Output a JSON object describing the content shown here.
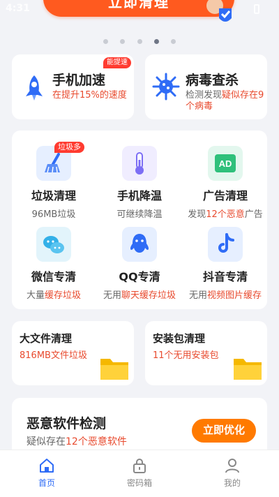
{
  "status_bar": {
    "time": "4:31"
  },
  "banner": {
    "clean_button_label": "立即清理"
  },
  "carousel": {
    "active_index": 3,
    "count": 5
  },
  "features": {
    "speedup": {
      "title": "手机加速",
      "desc": "在提升15%的速度",
      "badge": "能提速"
    },
    "antivirus": {
      "title": "病毒查杀",
      "desc_prefix": "检测发现",
      "desc_highlight": "疑似存在9个病毒"
    }
  },
  "grid": [
    {
      "title": "垃圾清理",
      "desc_plain": "",
      "desc_red": "96MB垃圾",
      "desc_tail": "",
      "badge": "垃圾多",
      "icon": "broom-icon"
    },
    {
      "title": "手机降温",
      "desc_plain": "",
      "desc_red": "可继续降温",
      "desc_tail": "",
      "icon": "thermometer-icon"
    },
    {
      "title": "广告清理",
      "desc_plain": "发现",
      "desc_red": "12个恶意",
      "desc_tail": "广告",
      "icon": "ad-icon"
    },
    {
      "title": "微信专清",
      "desc_plain": "大量",
      "desc_red": "缓存垃圾",
      "desc_tail": "",
      "icon": "wechat-icon"
    },
    {
      "title": "QQ专清",
      "desc_plain": "无用",
      "desc_red": "聊天缓存垃圾",
      "desc_tail": "",
      "icon": "qq-icon"
    },
    {
      "title": "抖音专清",
      "desc_plain": "无用",
      "desc_red": "视频图片缓存",
      "desc_tail": "",
      "icon": "tiktok-icon"
    }
  ],
  "files": {
    "large": {
      "title": "大文件清理",
      "desc": "816MB文件垃圾"
    },
    "apk": {
      "title": "安装包清理",
      "desc": "11个无用安装包"
    }
  },
  "malware": {
    "title": "恶意软件检测",
    "desc_plain": "疑似存在",
    "desc_red": "12个恶意软件",
    "button": "立即优化"
  },
  "tabs": [
    {
      "label": "首页",
      "icon": "home-icon"
    },
    {
      "label": "密码箱",
      "icon": "lock-icon"
    },
    {
      "label": "我的",
      "icon": "user-icon"
    }
  ],
  "colors": {
    "accent_orange": "#ff5a1f",
    "active_blue": "#2f6cf6",
    "highlight_red": "#e84a2e"
  }
}
